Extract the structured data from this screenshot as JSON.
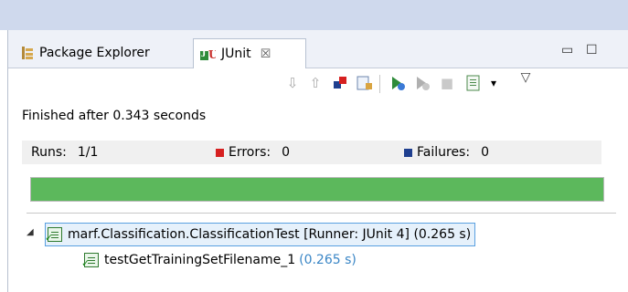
{
  "tabs": {
    "package_explorer": "Package Explorer",
    "junit": "JUnit",
    "close_glyph": "☒"
  },
  "window_buttons": {
    "minimize": "▭",
    "maximize": "☐"
  },
  "toolbar": {
    "next_failure": "⇩",
    "prev_failure": "⇧",
    "failures_only": "▣",
    "scroll_lock": "▤",
    "rerun": "▶",
    "rerun_failed_first": "▶",
    "stop": "■",
    "history": "▤",
    "history_dropdown": "▾",
    "view_menu": "▽"
  },
  "status": {
    "text": "Finished after 0.343 seconds"
  },
  "counters": {
    "runs_label": "Runs:",
    "runs_value": "1/1",
    "errors_label": "Errors:",
    "errors_value": "0",
    "failures_label": "Failures:",
    "failures_value": "0"
  },
  "progress": {
    "fraction": 1.0,
    "color": "#5cb85c"
  },
  "tree": {
    "root": {
      "label": "marf.Classification.ClassificationTest [Runner: JUnit 4] (0.265 s)",
      "expanded_glyph": "◢"
    },
    "children": [
      {
        "name": "testGetTrainingSetFilename_1",
        "time": "(0.265 s)"
      }
    ]
  },
  "colors": {
    "top_band": "#cfd9ed",
    "accent_time": "#3a86c6",
    "error_icon": "#d62020",
    "failure_icon": "#1f3f8f"
  }
}
